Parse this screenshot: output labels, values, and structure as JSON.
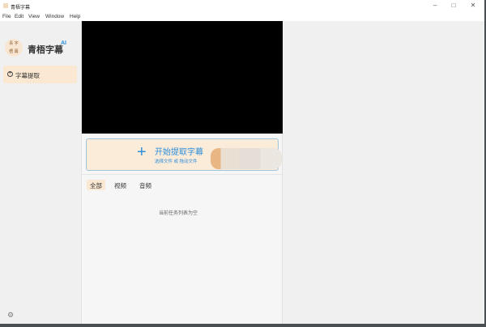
{
  "window": {
    "title": "青梧字幕",
    "minimize": "–",
    "maximize": "□",
    "close": "✕"
  },
  "menu": [
    "File",
    "Edit",
    "View",
    "Window",
    "Help"
  ],
  "sidebar": {
    "logo_text": "青梧字幕",
    "brand": "青梧字幕",
    "ai_badge": "AI",
    "items": [
      {
        "label": "字幕提取",
        "icon": "plus-circle-icon"
      }
    ],
    "settings_icon": "gear-icon"
  },
  "upload": {
    "title": "开始提取字幕",
    "subtitle": "选择文件 或 拖动文件"
  },
  "tabs": [
    {
      "label": "全部",
      "active": true
    },
    {
      "label": "视频"
    },
    {
      "label": "音频"
    }
  ],
  "empty_message": "当前任务列表为空"
}
